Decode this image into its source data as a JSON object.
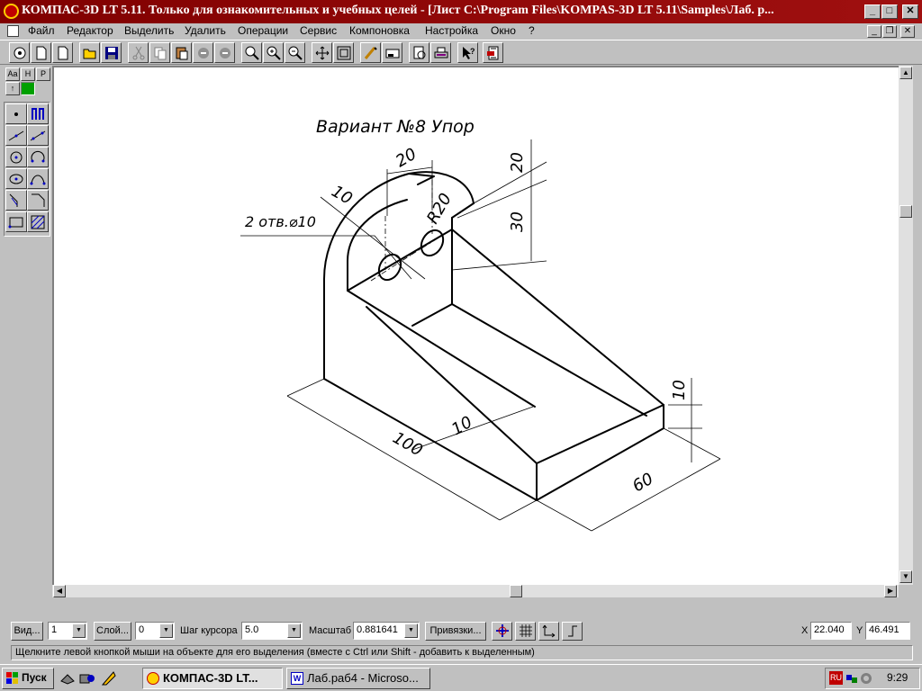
{
  "window": {
    "title": "КОМПАС-3D LT 5.11. Только для ознакомительных и учебных целей - [Лист C:\\Program Files\\KOMPAS-3D LT 5.11\\Samples\\Лаб. р..."
  },
  "menu": {
    "items": [
      "Файл",
      "Редактор",
      "Выделить",
      "Удалить",
      "Операции",
      "Сервис",
      "Компоновка",
      "Настройка",
      "Окно",
      "?"
    ]
  },
  "toolbar": {
    "icons": [
      "document-properties-icon",
      "new-sheet-icon",
      "new-fragment-icon",
      "open-icon",
      "save-icon",
      "cut-icon",
      "copy-icon",
      "paste-icon",
      "undo-icon",
      "redo-icon",
      "zoom-icon",
      "zoom-in-icon",
      "zoom-out-icon",
      "pan-icon",
      "zoom-all-icon",
      "refresh-icon",
      "layers-icon",
      "preview-icon",
      "print-icon",
      "help-pointer-icon",
      "manager-icon"
    ]
  },
  "left_panel": {
    "tabs": [
      "Аа",
      "Н",
      "Р"
    ]
  },
  "drawing": {
    "title": "Вариант №8  Упор",
    "dims": {
      "d20_top": "20",
      "d10_hole": "10",
      "holes": "2 отв.⌀10",
      "r20": "R20",
      "d20_right": "20",
      "d30": "30",
      "d10_rib": "10",
      "d100": "100",
      "d10_right": "10",
      "d60": "60"
    }
  },
  "property_bar": {
    "view_button": "Вид...",
    "view_value": "1",
    "layer_button": "Слой...",
    "layer_value": "0",
    "cursor_step_label": "Шаг курсора",
    "cursor_step_value": "5.0",
    "scale_label": "Масштаб",
    "scale_value": "0.881641",
    "snaps_button": "Привязки...",
    "x_label": "X",
    "x_value": "22.040",
    "y_label": "Y",
    "y_value": "46.491"
  },
  "status": {
    "message": "Щелкните левой кнопкой мыши на объекте для его выделения (вместе с Ctrl или Shift - добавить к выделенным)"
  },
  "taskbar": {
    "start": "Пуск",
    "tasks": [
      "КОМПАС-3D LT...",
      "Лаб.раб4 - Microso..."
    ],
    "lang": "RU",
    "time": "9:29"
  },
  "colors": {
    "titlebar": "#800000",
    "face": "#c0c0c0",
    "canvas": "#ffffff"
  }
}
